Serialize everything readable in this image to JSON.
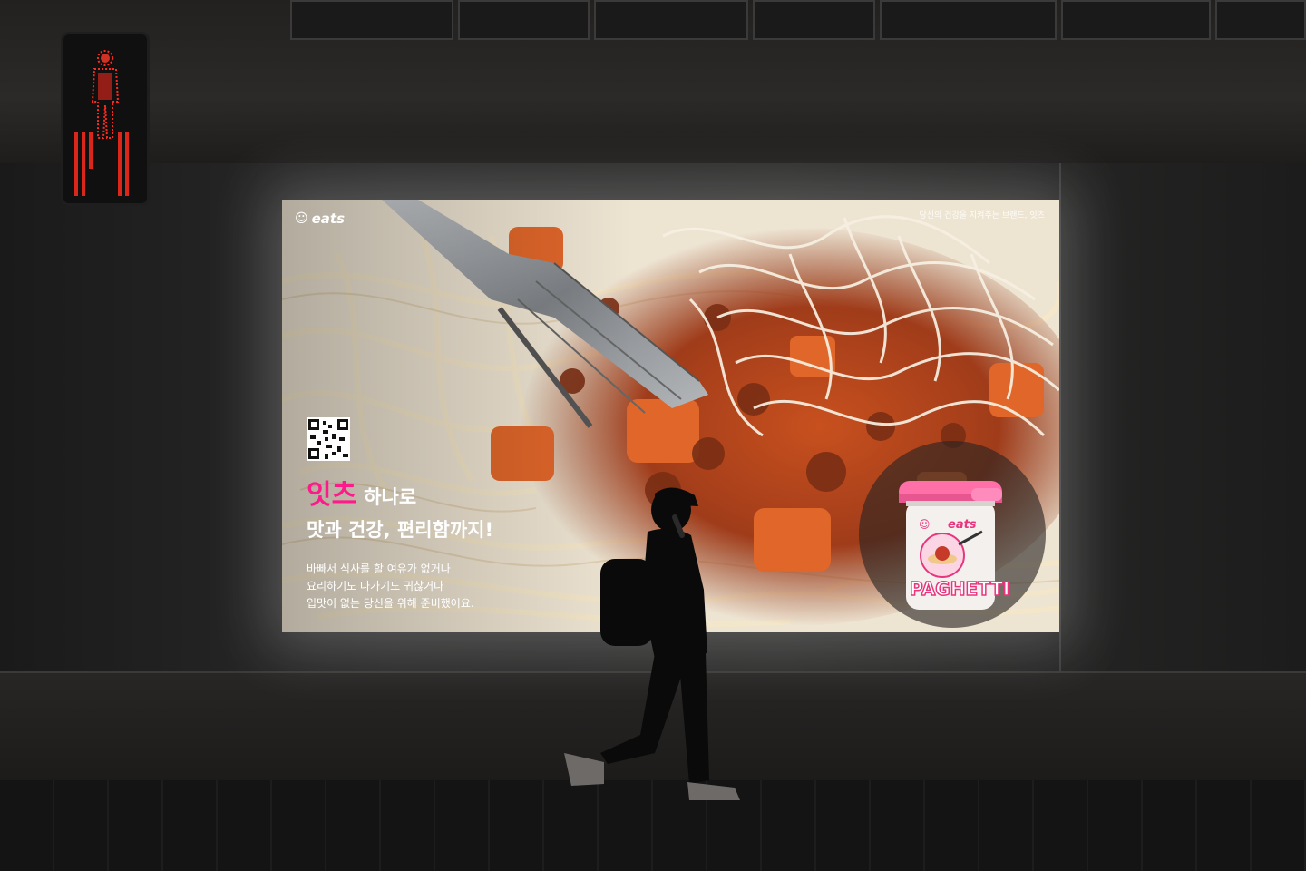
{
  "billboard": {
    "logo_text": "eats",
    "logo_icon": "smile-icon",
    "tagline": "당신의 건강을 지켜주는 브랜드, 잇츠",
    "headline_brand": "잇츠",
    "headline_rest": "하나로",
    "headline_line2": "맛과 건강, 편리함까지!",
    "body_lines": [
      "바빠서 식사를 할 여유가 없거나",
      "요리하기도 나가기도 귀찮거나",
      "입맛이 없는 당신을 위해 준비했어요."
    ],
    "jar_logo": "eats",
    "jar_label": "PAGHETTI",
    "brand_color": "#ff1a8c"
  },
  "traffic_light": {
    "state": "red-pedestrian",
    "color": "#ff2a1f"
  }
}
